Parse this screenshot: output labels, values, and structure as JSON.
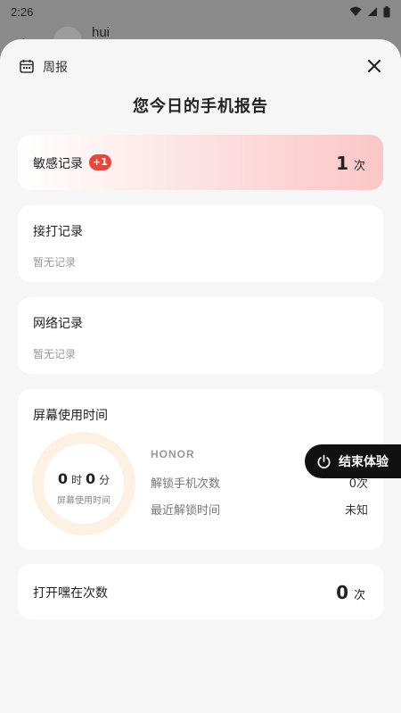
{
  "status_bar": {
    "time": "2:26"
  },
  "background_app": {
    "contact_name": "hui"
  },
  "sheet": {
    "header_label": "周报",
    "title": "您今日的手机报告"
  },
  "sensitive": {
    "title": "敏感记录",
    "badge": "+1",
    "count": "1",
    "unit": "次"
  },
  "calls": {
    "title": "接打记录",
    "empty": "暂无记录"
  },
  "network": {
    "title": "网络记录",
    "empty": "暂无记录"
  },
  "screen": {
    "title": "屏幕使用时间",
    "hours": "0",
    "hours_unit": "时",
    "minutes": "0",
    "minutes_unit": "分",
    "ring_label": "屏幕使用时间",
    "brand": "HONOR",
    "unlock_label": "解锁手机次数",
    "unlock_value": "0次",
    "last_unlock_label": "最近解锁时间",
    "last_unlock_value": "未知"
  },
  "opens": {
    "title": "打开嘿在次数",
    "count": "0",
    "unit": "次"
  },
  "end_button": {
    "label": "结束体验"
  },
  "colors": {
    "badge": "#e8453c",
    "sensitive_gradient_end": "#fbc6c6",
    "ring": "#fdf1e3",
    "end_button_bg": "#111111"
  }
}
